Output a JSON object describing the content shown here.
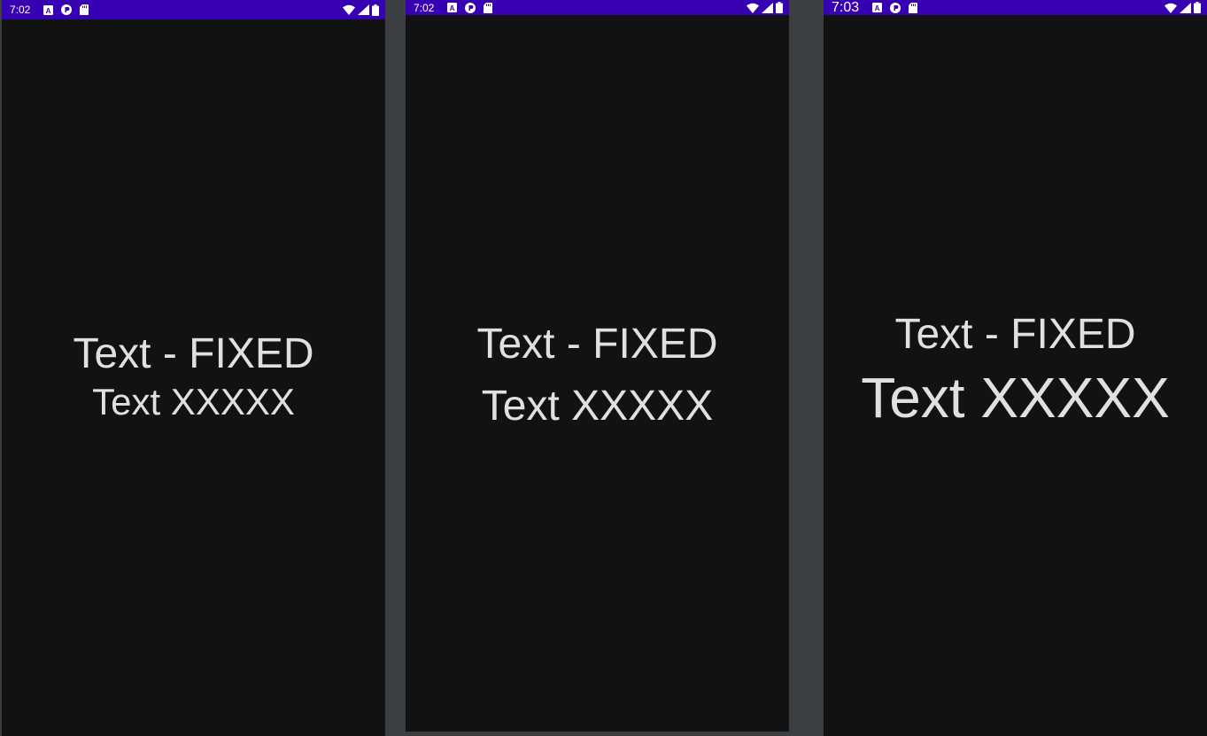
{
  "colors": {
    "status_bar": "#3700b3",
    "screen_background": "#121212",
    "text": "#e0e0e0",
    "gap_background": "#3c3f41"
  },
  "status_icons": [
    "app-a-icon",
    "app-p-icon",
    "sd-card-icon",
    "wifi-icon",
    "cell-signal-icon",
    "battery-icon"
  ],
  "screens": [
    {
      "time": "7:02",
      "fixed_text": "Text - FIXED",
      "variable_text": "Text XXXXX"
    },
    {
      "time": "7:02",
      "fixed_text": "Text - FIXED",
      "variable_text": "Text XXXXX"
    },
    {
      "time": "7:03",
      "fixed_text": "Text - FIXED",
      "variable_text": "Text XXXXX"
    }
  ]
}
